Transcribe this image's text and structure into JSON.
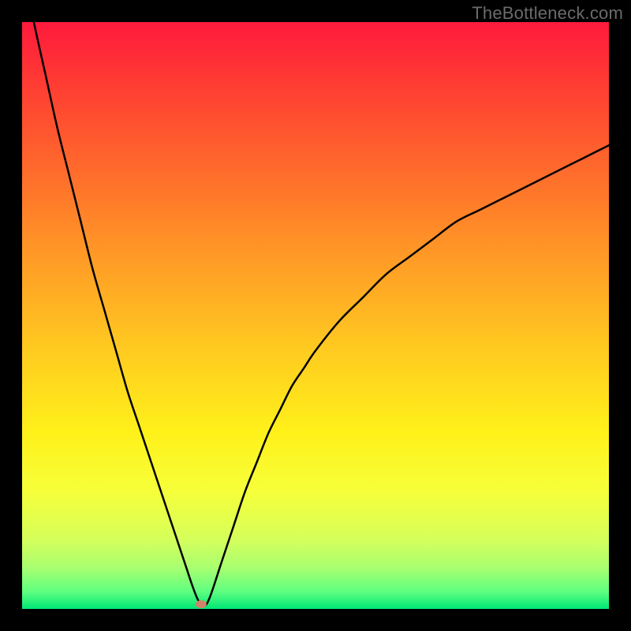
{
  "watermark": {
    "text": "TheBottleneck.com"
  },
  "chart_data": {
    "type": "line",
    "title": "",
    "xlabel": "",
    "ylabel": "",
    "xlim": [
      0,
      100
    ],
    "ylim": [
      0,
      100
    ],
    "x": [
      0,
      2,
      4,
      6,
      8,
      10,
      12,
      14,
      16,
      18,
      20,
      22,
      24,
      26,
      27,
      28,
      29,
      30,
      31,
      32,
      34,
      36,
      38,
      40,
      42,
      44,
      46,
      48,
      50,
      54,
      58,
      62,
      66,
      70,
      74,
      78,
      82,
      86,
      90,
      94,
      98,
      100
    ],
    "series": [
      {
        "name": "curve",
        "values": [
          110,
          100,
          91,
          82,
          74,
          66,
          58,
          51,
          44,
          37,
          31,
          25,
          19,
          13,
          10,
          7,
          4,
          1.5,
          0.5,
          2,
          8,
          14,
          20,
          25,
          30,
          34,
          38,
          41,
          44,
          49,
          53,
          57,
          60,
          63,
          66,
          68,
          70,
          72,
          74,
          76,
          78,
          79
        ]
      }
    ],
    "gradient_stops": [
      {
        "offset": 0.0,
        "color": "#ff1a3c"
      },
      {
        "offset": 0.1,
        "color": "#ff3a33"
      },
      {
        "offset": 0.25,
        "color": "#ff6a2c"
      },
      {
        "offset": 0.4,
        "color": "#ff9a26"
      },
      {
        "offset": 0.55,
        "color": "#ffc820"
      },
      {
        "offset": 0.7,
        "color": "#fff11a"
      },
      {
        "offset": 0.8,
        "color": "#f6ff3a"
      },
      {
        "offset": 0.88,
        "color": "#d6ff5a"
      },
      {
        "offset": 0.93,
        "color": "#a8ff70"
      },
      {
        "offset": 0.97,
        "color": "#60ff80"
      },
      {
        "offset": 1.0,
        "color": "#00e676"
      }
    ],
    "marker": {
      "x": 30.5,
      "y": 0.8,
      "rx": 7,
      "ry": 5,
      "color": "#cf8469"
    }
  }
}
